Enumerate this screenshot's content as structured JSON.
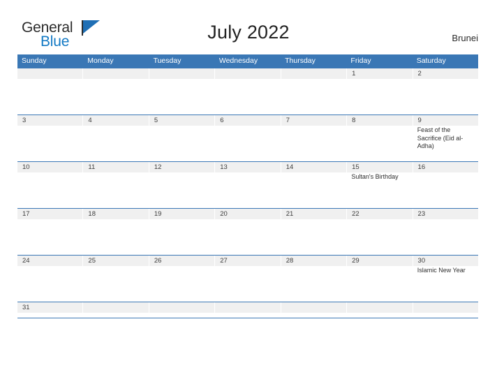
{
  "brand": {
    "name_part1": "General",
    "name_part2": "Blue",
    "flag_icon": "flag-triangle-icon"
  },
  "header": {
    "title": "July 2022",
    "region": "Brunei"
  },
  "calendar": {
    "weekdays": [
      "Sunday",
      "Monday",
      "Tuesday",
      "Wednesday",
      "Thursday",
      "Friday",
      "Saturday"
    ],
    "colors": {
      "header_blue": "#3a77b5",
      "number_band_gray": "#f0f0f0",
      "logo_blue": "#1279c4",
      "text_dark": "#2b2b2b"
    },
    "weeks": [
      {
        "days": [
          {
            "num": "",
            "events": []
          },
          {
            "num": "",
            "events": []
          },
          {
            "num": "",
            "events": []
          },
          {
            "num": "",
            "events": []
          },
          {
            "num": "",
            "events": []
          },
          {
            "num": "1",
            "events": []
          },
          {
            "num": "2",
            "events": []
          }
        ]
      },
      {
        "days": [
          {
            "num": "3",
            "events": []
          },
          {
            "num": "4",
            "events": []
          },
          {
            "num": "5",
            "events": []
          },
          {
            "num": "6",
            "events": []
          },
          {
            "num": "7",
            "events": []
          },
          {
            "num": "8",
            "events": []
          },
          {
            "num": "9",
            "events": [
              "Feast of the Sacrifice (Eid al-Adha)"
            ]
          }
        ]
      },
      {
        "days": [
          {
            "num": "10",
            "events": []
          },
          {
            "num": "11",
            "events": []
          },
          {
            "num": "12",
            "events": []
          },
          {
            "num": "13",
            "events": []
          },
          {
            "num": "14",
            "events": []
          },
          {
            "num": "15",
            "events": [
              "Sultan's Birthday"
            ]
          },
          {
            "num": "16",
            "events": []
          }
        ]
      },
      {
        "days": [
          {
            "num": "17",
            "events": []
          },
          {
            "num": "18",
            "events": []
          },
          {
            "num": "19",
            "events": []
          },
          {
            "num": "20",
            "events": []
          },
          {
            "num": "21",
            "events": []
          },
          {
            "num": "22",
            "events": []
          },
          {
            "num": "23",
            "events": []
          }
        ]
      },
      {
        "days": [
          {
            "num": "24",
            "events": []
          },
          {
            "num": "25",
            "events": []
          },
          {
            "num": "26",
            "events": []
          },
          {
            "num": "27",
            "events": []
          },
          {
            "num": "28",
            "events": []
          },
          {
            "num": "29",
            "events": []
          },
          {
            "num": "30",
            "events": [
              "Islamic New Year"
            ]
          }
        ]
      },
      {
        "days": [
          {
            "num": "31",
            "events": []
          },
          {
            "num": "",
            "events": []
          },
          {
            "num": "",
            "events": []
          },
          {
            "num": "",
            "events": []
          },
          {
            "num": "",
            "events": []
          },
          {
            "num": "",
            "events": []
          },
          {
            "num": "",
            "events": []
          }
        ]
      }
    ]
  }
}
